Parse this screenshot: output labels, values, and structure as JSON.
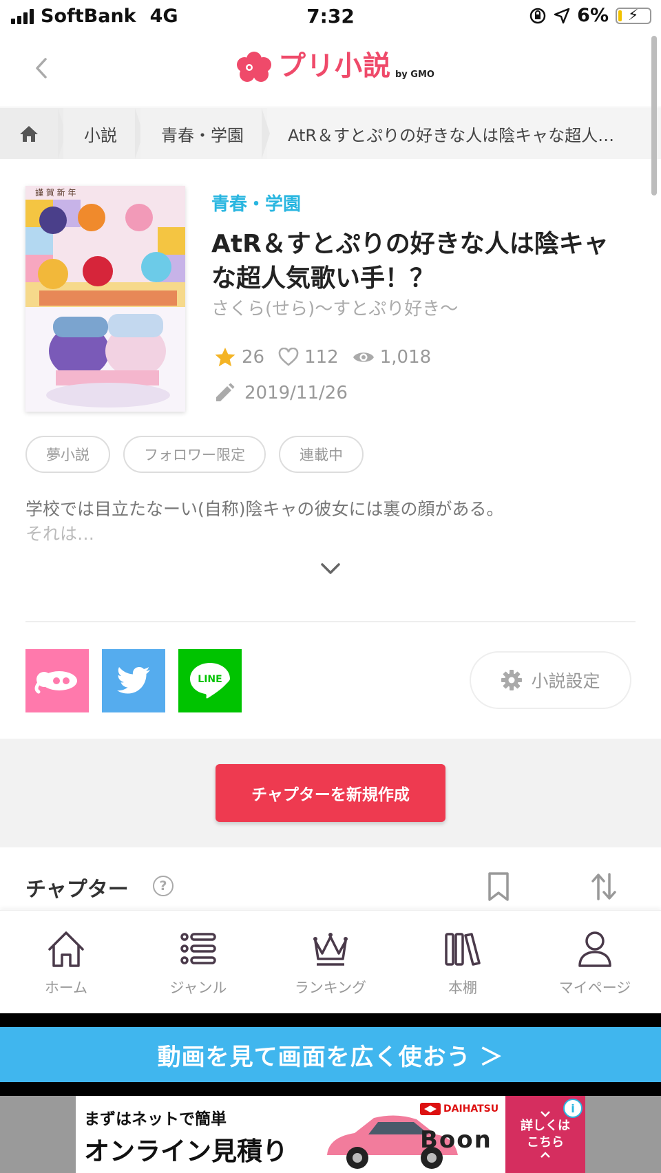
{
  "status_bar": {
    "carrier": "SoftBank",
    "network": "4G",
    "time": "7:32",
    "battery": "6%"
  },
  "header": {
    "logo_text": "プリ小説",
    "logo_by": "by GMO"
  },
  "breadcrumb": {
    "items": [
      "小説",
      "青春・学園",
      "AtR＆すとぷりの好きな人は陰キャな超人…"
    ]
  },
  "novel": {
    "genre": "青春・学園",
    "title": "AtR＆すとぷりの好きな人は陰キャな超人気歌い手！？",
    "author": "さくら(せら)〜すとぷり好き〜",
    "stars": "26",
    "likes": "112",
    "views": "1,018",
    "updated": "2019/11/26",
    "tags": [
      "夢小説",
      "フォロワー限定",
      "連載中"
    ],
    "description_line1": "学校では目立たなーい(自称)陰キャの彼女には裏の顔がある。",
    "description_line2": "それは…"
  },
  "actions": {
    "settings_label": "小説設定",
    "create_chapter_label": "チャプターを新規作成"
  },
  "chapters": {
    "title": "チャプター",
    "help": "?"
  },
  "tabs": [
    {
      "label": "ホーム",
      "icon": "home-icon"
    },
    {
      "label": "ジャンル",
      "icon": "list-icon"
    },
    {
      "label": "ランキング",
      "icon": "crown-icon"
    },
    {
      "label": "本棚",
      "icon": "bookshelf-icon"
    },
    {
      "label": "マイページ",
      "icon": "person-icon"
    }
  ],
  "promo": {
    "text": "動画を見て画面を広く使おう ＞"
  },
  "ad": {
    "line1": "まずはネットで簡単",
    "line2": "オンライン見積り",
    "brand": "DAIHATSU",
    "model": "Boon",
    "cta": "詳しくは こちら"
  },
  "colors": {
    "accent": "#ef4a6a",
    "genre": "#29b6e0",
    "create": "#ee3a50",
    "promo": "#40b6ee"
  }
}
